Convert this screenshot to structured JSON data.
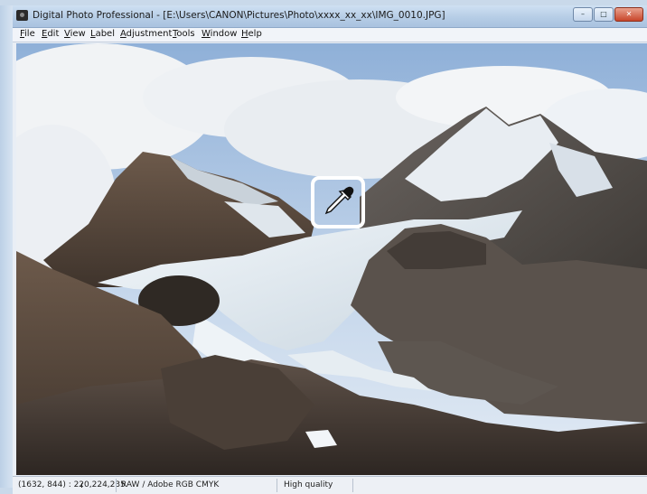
{
  "window": {
    "title": "Digital Photo Professional - [E:\\Users\\CANON\\Pictures\\Photo\\xxxx_xx_xx\\IMG_0010.JPG]",
    "controls": {
      "minimize": "–",
      "maximize": "□",
      "close": "✕"
    }
  },
  "menu": {
    "items": [
      "File",
      "Edit",
      "View",
      "Label",
      "Adjustment",
      "Tools",
      "Window",
      "Help"
    ]
  },
  "image": {
    "description_icon": "mountain-glacier-photo"
  },
  "tool": {
    "icon": "eyedropper-icon"
  },
  "status": {
    "pixel_info": "(1632, 844) : 220,224,235",
    "color_mode": "RAW / Adobe RGB  CMYK",
    "quality": "High quality"
  },
  "colors": {
    "titlebar": "#b6cde6",
    "accent_highlight": "#ffffff",
    "close_button": "#c8452a"
  }
}
